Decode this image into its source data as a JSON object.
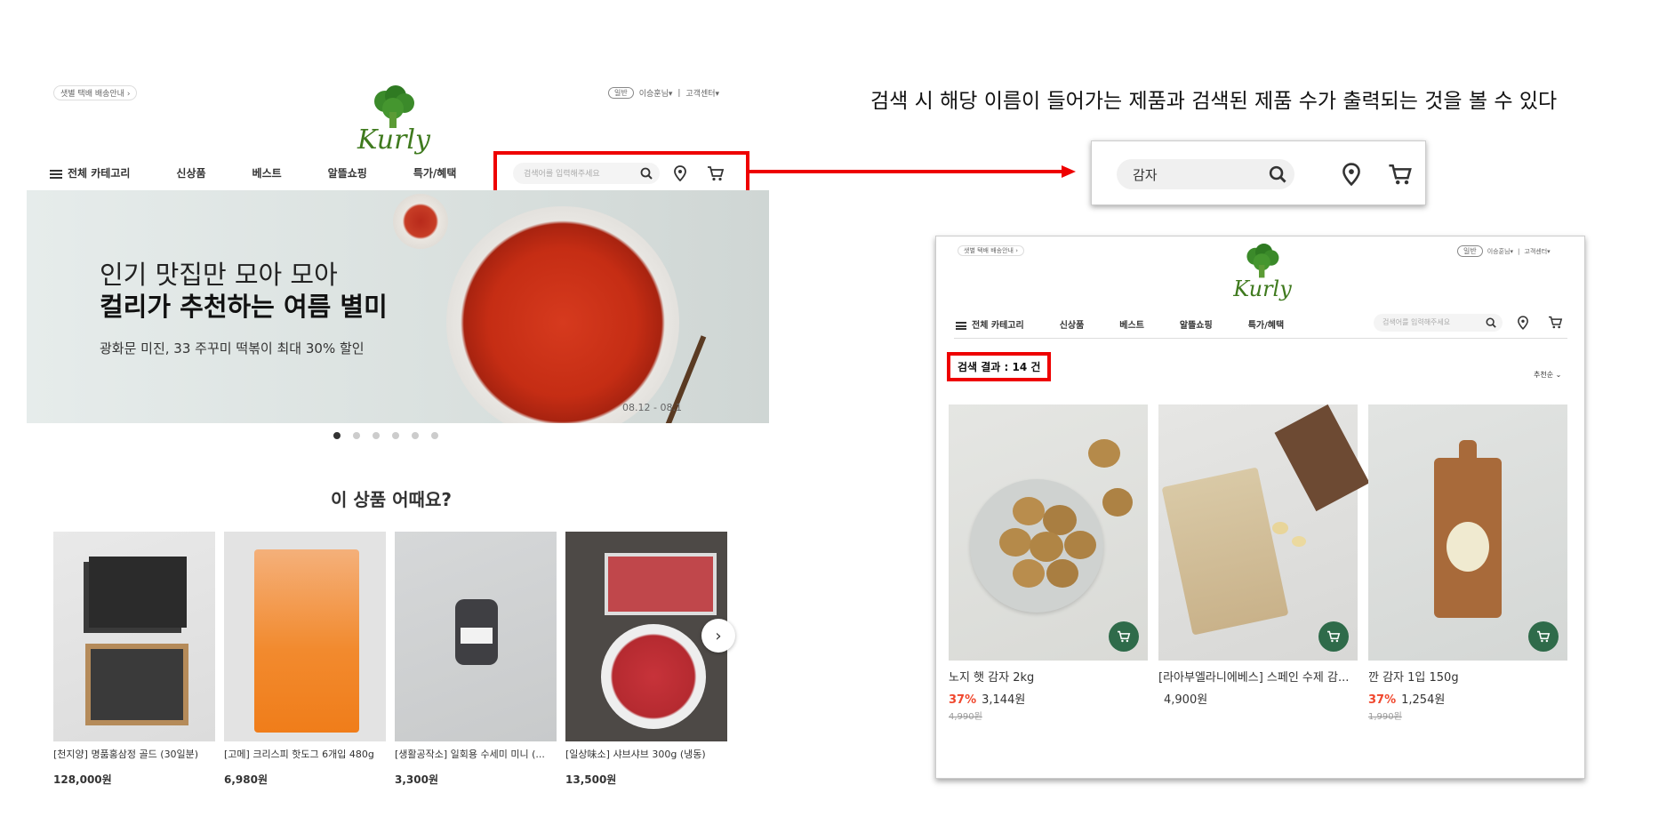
{
  "colors": {
    "accent_red": "#e00000",
    "brand_green": "#3f7a1e",
    "discount": "#f0472d",
    "cart_green": "#2f6b4a"
  },
  "caption": "검색 시 해당 이름이 들어가는 제품과 검색된 제품 수가 출력되는 것을 볼 수 있다",
  "main": {
    "delivery_badge": "샛별 택배 배송안내 ›",
    "util": {
      "login_pill": "일반",
      "user": "이승훈님▾",
      "sep": "|",
      "support": "고객센터▾"
    },
    "logo": "Kurly",
    "nav": {
      "all_category": "전체 카테고리",
      "items": [
        "신상품",
        "베스트",
        "알뜰쇼핑",
        "특가/혜택"
      ]
    },
    "search_placeholder": "검색어를 입력해주세요",
    "hero": {
      "line1": "인기 맛집만 모아 모아",
      "line2": "컬리가 추천하는 여름 별미",
      "line3": "광화문 미진, 33 주꾸미 떡볶이 최대 30% 할인",
      "date": "08.12 - 08.1"
    },
    "section_title": "이 상품 어때요?",
    "products": [
      {
        "name": "[천지양] 명품홍삼정 골드 (30일분)",
        "price": "128,000원"
      },
      {
        "name": "[고메] 크리스피 핫도그 6개입 480g",
        "price": "6,980원"
      },
      {
        "name": "[생활공작소] 일회용 수세미 미니 (...",
        "price": "3,300원"
      },
      {
        "name": "[일상味소] 샤브샤브 300g (냉동)",
        "price": "13,500원"
      }
    ]
  },
  "zoom": {
    "search_value": "감자"
  },
  "result": {
    "delivery_badge": "샛별 택배 배송안내 ›",
    "util": {
      "login_pill": "일반",
      "user": "이승훈님▾",
      "sep": "|",
      "support": "고객센터▾"
    },
    "logo": "Kurly",
    "nav": {
      "all_category": "전체 카테고리",
      "items": [
        "신상품",
        "베스트",
        "알뜰쇼핑",
        "특가/혜택"
      ]
    },
    "search_placeholder": "검색어를 입력해주세요",
    "count_label": "검색 결과 : 14 건",
    "sort_label": "추천순 ⌄",
    "products": [
      {
        "name": "노지 햇 감자 2kg",
        "discount": "37%",
        "price": "3,144원",
        "original": "4,990원"
      },
      {
        "name": "[라아부엘라니에베스] 스페인 수제 감...",
        "discount": "",
        "price": "4,900원",
        "original": ""
      },
      {
        "name": "깐 감자 1입 150g",
        "discount": "37%",
        "price": "1,254원",
        "original": "1,990원"
      }
    ]
  }
}
